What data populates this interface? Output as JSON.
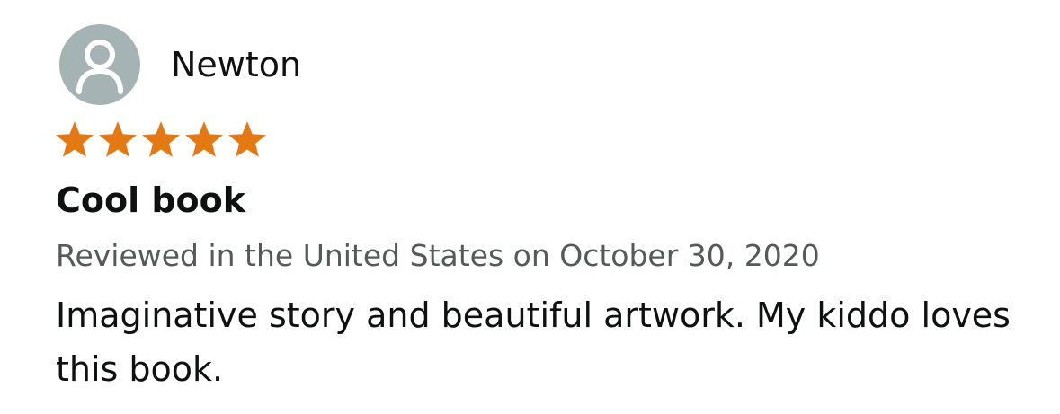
{
  "review": {
    "profile": {
      "name": "Newton",
      "avatar_icon": "default-user-icon",
      "avatar_color": "#a6b3b5"
    },
    "rating": {
      "value": 5,
      "max": 5,
      "star_color": "#e47911",
      "star_icon": "star-icon"
    },
    "title": "Cool book",
    "date_line": "Reviewed in the United States on October 30, 2020",
    "body": "Imaginative story and beautiful artwork. My kiddo loves this book."
  }
}
